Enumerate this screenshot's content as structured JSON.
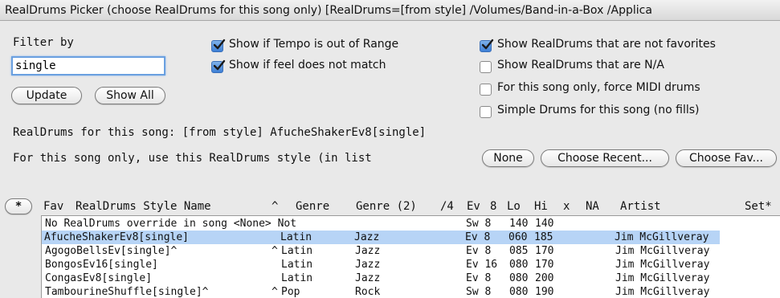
{
  "window": {
    "title": "RealDrums Picker (choose RealDrums for this song only)  [RealDrums=[from style] /Volumes/Band-in-a-Box /Applica"
  },
  "filter": {
    "label": "Filter by",
    "value": "single",
    "update_label": "Update",
    "show_all_label": "Show All"
  },
  "options": {
    "tempo_out_of_range": {
      "label": "Show if Tempo is out of Range",
      "checked": true
    },
    "feel_not_match": {
      "label": "Show if feel does not match",
      "checked": true
    },
    "not_favorites": {
      "label": "Show RealDrums that are not favorites",
      "checked": true
    },
    "na": {
      "label": "Show RealDrums that are N/A",
      "checked": false
    },
    "force_midi": {
      "label": "For this song only, force MIDI drums",
      "checked": false
    },
    "simple_drums": {
      "label": "Simple Drums for this song (no fills)",
      "checked": false
    }
  },
  "song_info": {
    "current": "RealDrums for this song: [from style] AfucheShakerEv8[single]",
    "use_style": "For this song only, use this RealDrums style (in list"
  },
  "actions": {
    "none_label": "None",
    "recent_label": "Choose Recent...",
    "fav_label": "Choose Fav..."
  },
  "table": {
    "star_label": "*",
    "headers": {
      "fav": "Fav",
      "name": "RealDrums Style Name",
      "caret": "^",
      "genre": "Genre",
      "genre2": "Genre (2)",
      "time": "/4",
      "ev": "Ev",
      "eight": "8",
      "lo": "Lo",
      "hi": "Hi",
      "x": "x",
      "na": "NA",
      "artist": "Artist",
      "set": "Set*"
    },
    "rows": [
      {
        "name": "No RealDrums override in song <None> Not",
        "caret": "",
        "genre": "",
        "genre2": "",
        "feel": "Sw 8",
        "lo": "140",
        "hi": "140",
        "artist": "",
        "selected": false
      },
      {
        "name": "AfucheShakerEv8[single]",
        "caret": "",
        "genre": "Latin",
        "genre2": "Jazz",
        "feel": "Ev 8",
        "lo": "060",
        "hi": "185",
        "artist": "Jim McGillveray",
        "selected": true
      },
      {
        "name": "AgogoBellsEv[single]^",
        "caret": "^",
        "genre": "Latin",
        "genre2": "Jazz",
        "feel": "Ev 8",
        "lo": "085",
        "hi": "170",
        "artist": "Jim McGillveray",
        "selected": false
      },
      {
        "name": "BongosEv16[single]",
        "caret": "",
        "genre": "Latin",
        "genre2": "Jazz",
        "feel": "Ev 16",
        "lo": "080",
        "hi": "170",
        "artist": "Jim McGillveray",
        "selected": false
      },
      {
        "name": "CongasEv8[single]",
        "caret": "",
        "genre": "Latin",
        "genre2": "Jazz",
        "feel": "Ev 8",
        "lo": "080",
        "hi": "200",
        "artist": "Jim McGillveray",
        "selected": false
      },
      {
        "name": "TambourineShuffle[single]^",
        "caret": "^",
        "genre": "Pop",
        "genre2": "Rock",
        "feel": "Sw 8",
        "lo": "080",
        "hi": "190",
        "artist": "Jim McGillveray",
        "selected": false
      }
    ]
  }
}
